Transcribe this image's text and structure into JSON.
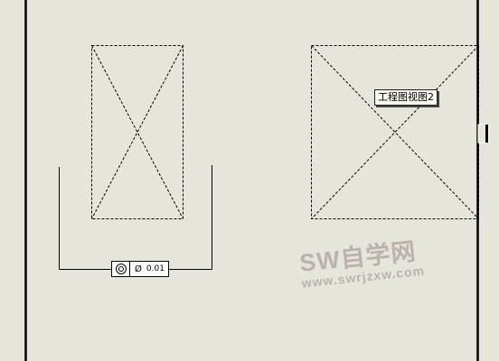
{
  "view_tooltip": {
    "label": "工程图视图2"
  },
  "fcf": {
    "symbol_icon": "concentricity-icon",
    "diameter_symbol": "Ø",
    "tolerance": "0.01"
  },
  "watermark": {
    "title": "SW自学网",
    "url": "www.swrjzxw.com"
  },
  "colors": {
    "background": "#e6e5db",
    "watermark": "#b9b0ad"
  }
}
